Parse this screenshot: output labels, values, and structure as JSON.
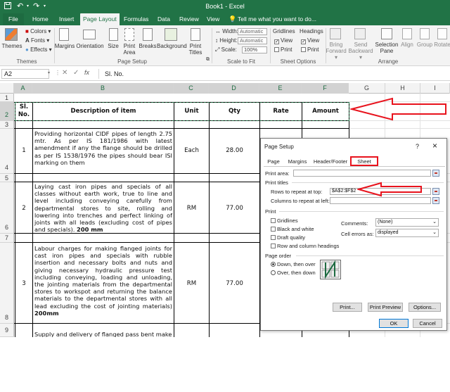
{
  "window": {
    "title": "Book1 - Excel",
    "tell_me": "Tell me what you want to do..."
  },
  "tabs": [
    "File",
    "Home",
    "Insert",
    "Page Layout",
    "Formulas",
    "Data",
    "Review",
    "View"
  ],
  "ribbon": {
    "themes": {
      "label": "Themes",
      "colors": "Colors",
      "fonts": "Fonts",
      "effects": "Effects",
      "themes_btn": "Themes"
    },
    "page_setup": {
      "label": "Page Setup",
      "margins": "Margins",
      "orientation": "Orientation",
      "size": "Size",
      "print_area_1": "Print",
      "print_area_2": "Area",
      "breaks": "Breaks",
      "background": "Background",
      "print_titles_1": "Print",
      "print_titles_2": "Titles"
    },
    "scale_to_fit": {
      "label": "Scale to Fit",
      "width_label": "Width:",
      "width_value": "Automatic",
      "height_label": "Height:",
      "height_value": "Automatic",
      "scale_label": "Scale:",
      "scale_value": "100%"
    },
    "sheet_options": {
      "label": "Sheet Options",
      "gridlines": "Gridlines",
      "headings": "Headings",
      "view1": "View",
      "print1": "Print",
      "view2": "View",
      "print2": "Print"
    },
    "arrange": {
      "label": "Arrange",
      "bring_forward_1": "Bring",
      "bring_forward_2": "Forward",
      "send_backward_1": "Send",
      "send_backward_2": "Backward",
      "selection_pane_1": "Selection",
      "selection_pane_2": "Pane",
      "align": "Align",
      "group": "Group",
      "rotate": "Rotate"
    }
  },
  "formula_bar": {
    "name_box": "A2",
    "fx": "fx",
    "content": "Sl. No."
  },
  "columns": [
    "A",
    "B",
    "C",
    "D",
    "E",
    "F",
    "G",
    "H",
    "I"
  ],
  "rows": [
    "1",
    "2",
    "3",
    "4",
    "5",
    "6",
    "7",
    "8",
    "9"
  ],
  "table": {
    "headers": {
      "sl": "Sl. No.",
      "sl_1": "Sl.",
      "sl_2": "No.",
      "description": "Description of item",
      "unit": "Unit",
      "qty": "Qty",
      "rate": "Rate",
      "amount": "Amount"
    },
    "items": [
      {
        "sl": "1",
        "description": "Providing horizontal CIDF pipes of length 2.75 mtr. As per IS 181/1986 with latest amendment if any the flange should be drilled as per IS 1538/1976 the pipes should bear ISI marking on them",
        "unit": "Each",
        "qty": "28.00"
      },
      {
        "sl": "2",
        "description": "Laying cast iron pipes and specials of all classes without earth work, true to line and level including conveying carefully from departmental stores to site, rolling and lowering into trenches and perfect linking of joints with all leads (excluding cost of pipes and specials).",
        "description_bold": "200 mm",
        "unit": "RM",
        "qty": "77.00"
      },
      {
        "sl": "3",
        "description": "Labour charges for making flanged joints for cast iron pipes and specials with rubble insertion and necessary bolts and nuts and giving necessary hydraulic pressure test including conveying, loading and unloading, the jointing materials from the departmental stores to workspot and returning the balance materials to the departmental stores with all lead excluding the cost of jointing materials)",
        "description_bold": "200mm",
        "unit": "RM",
        "qty": "77.00"
      }
    ],
    "row9_partial": "Supply and delivery of flanged pass bent make"
  },
  "dialog": {
    "title": "Page Setup",
    "help": "?",
    "close": "×",
    "tabs": [
      "Page",
      "Margins",
      "Header/Footer",
      "Sheet"
    ],
    "active_tab": "Sheet",
    "print_area_label": "Print area:",
    "print_titles_label": "Print titles",
    "rows_repeat_label": "Rows to repeat at top:",
    "rows_repeat_value": "$A$2:$F$2",
    "cols_repeat_label": "Columns to repeat at left:",
    "print_section": "Print",
    "gridlines": "Gridlines",
    "black_white": "Black and white",
    "draft_quality": "Draft quality",
    "row_col_headings": "Row and column headings",
    "comments_label": "Comments:",
    "comments_value": "(None)",
    "cell_errors_label": "Cell errors as:",
    "cell_errors_value": "displayed",
    "page_order_label": "Page order",
    "down_then_over": "Down, then over",
    "over_then_down": "Over, then down",
    "print_btn": "Print...",
    "print_preview_btn": "Print Preview",
    "options_btn": "Options...",
    "ok_btn": "OK",
    "cancel_btn": "Cancel"
  },
  "colors": {
    "excel_green": "#217346",
    "annotation_red": "#e8131d",
    "selection_green": "#1e6b41"
  }
}
